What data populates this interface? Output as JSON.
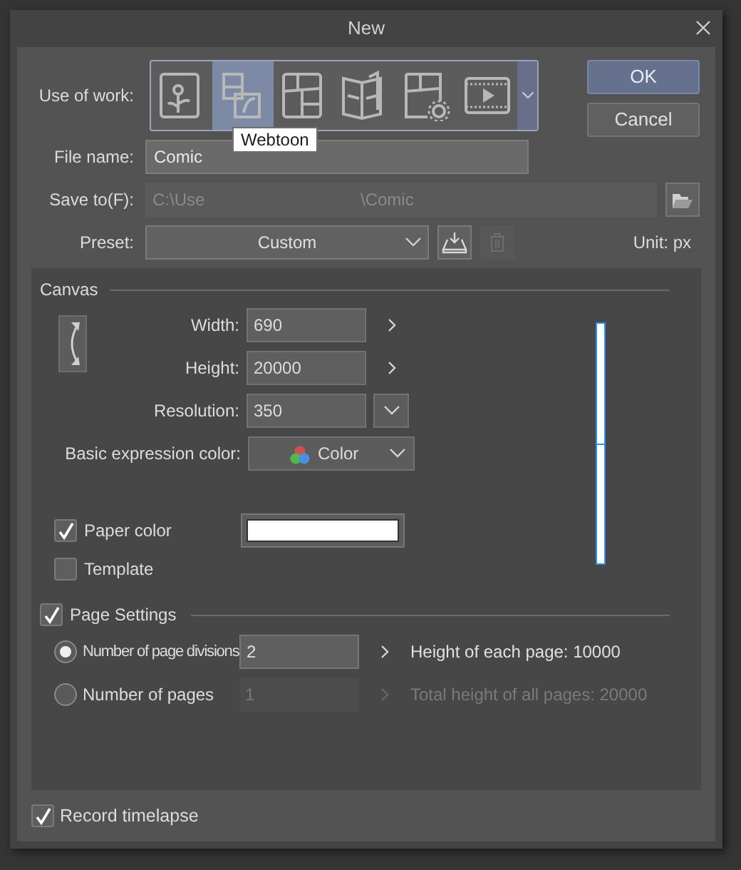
{
  "window": {
    "title": "New"
  },
  "use_of_work": {
    "label": "Use of work:",
    "options": [
      {
        "kind": "illustration",
        "selected": false
      },
      {
        "kind": "webtoon",
        "selected": true
      },
      {
        "kind": "comic",
        "selected": false
      },
      {
        "kind": "book",
        "selected": false
      },
      {
        "kind": "comic-settings",
        "selected": false
      },
      {
        "kind": "animation",
        "selected": false
      }
    ],
    "tooltip": "Webtoon"
  },
  "buttons": [
    {
      "label": "OK",
      "kind": "default"
    },
    {
      "label": "Cancel",
      "kind": "normal"
    }
  ],
  "file_name": {
    "label": "File name:",
    "value": "Comic"
  },
  "save_to": {
    "label": "Save to(F):",
    "value_start": "C:\\Use",
    "value_end": "\\Comic"
  },
  "preset": {
    "label": "Preset:",
    "value": "Custom",
    "unit": "Unit: px"
  },
  "canvas": {
    "title": "Canvas",
    "fields": [
      {
        "label": "Width:",
        "value": "690",
        "kind": "arrow"
      },
      {
        "label": "Height:",
        "value": "20000",
        "kind": "arrow"
      },
      {
        "label": "Resolution:",
        "value": "350",
        "kind": "dropdown"
      }
    ],
    "color_mode": {
      "label": "Basic expression color:",
      "value": "Color"
    },
    "paper_color": {
      "label": "Paper color",
      "checked": true,
      "color": "#ffffff"
    },
    "template": {
      "label": "Template",
      "checked": false
    }
  },
  "page_settings": {
    "label": "Page Settings",
    "checked": true,
    "options": [
      {
        "label": "Number of page divisions",
        "selected": true,
        "value": "2",
        "info": "Height of each page: 10000"
      },
      {
        "label": "Number of pages",
        "selected": false,
        "value": "1",
        "info": "Total height of all pages: 20000"
      }
    ]
  },
  "record_timelapse": {
    "label": "Record timelapse",
    "checked": true
  }
}
